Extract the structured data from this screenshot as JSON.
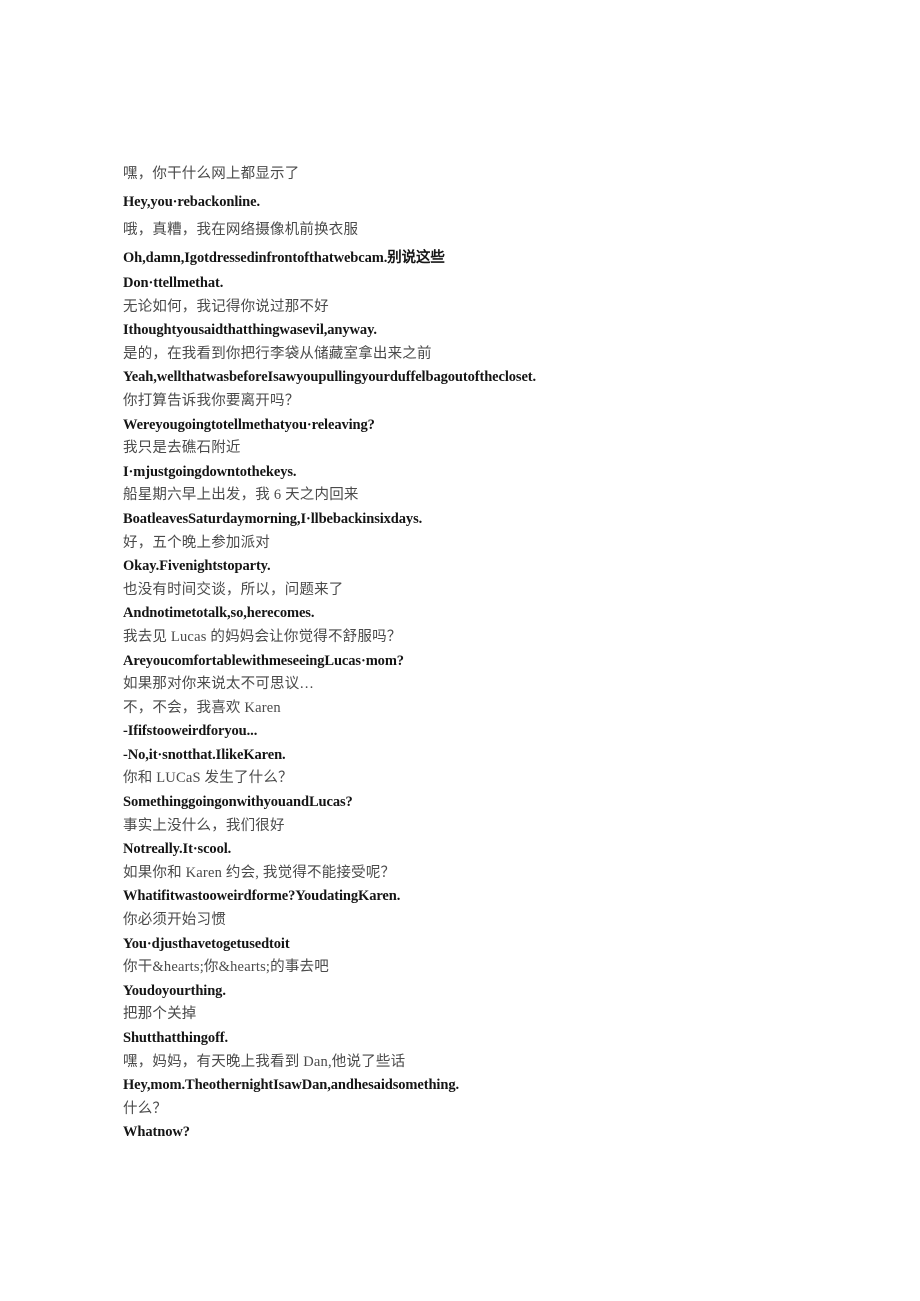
{
  "document": {
    "page_background": "#ffffff",
    "text_color_chinese": "#4a4a4a",
    "text_color_english": "#151515",
    "lines": [
      {
        "id": "l01",
        "lang": "zh",
        "spacing": "loose",
        "text": "嘿，你干什么网上都显示了"
      },
      {
        "id": "l02",
        "lang": "en",
        "spacing": "loose",
        "text": "Hey,you·rebackonline."
      },
      {
        "id": "l03",
        "lang": "zh",
        "spacing": "loose",
        "text": "哦，真糟，我在网络摄像机前换衣服"
      },
      {
        "id": "l04",
        "lang": "mixed",
        "spacing": "loose",
        "text": "Oh,damn,Igotdressedinfrontofthatwebcam.别说这些"
      },
      {
        "id": "l05",
        "lang": "en",
        "spacing": "normal",
        "text": "Don·ttellmethat."
      },
      {
        "id": "l06",
        "lang": "zh",
        "spacing": "normal",
        "text": "无论如何，我记得你说过那不好"
      },
      {
        "id": "l07",
        "lang": "en",
        "spacing": "normal",
        "text": "Ithoughtyousaidthatthingwasevil,anyway."
      },
      {
        "id": "l08",
        "lang": "zh",
        "spacing": "normal",
        "text": "是的，在我看到你把行李袋从储藏室拿出来之前"
      },
      {
        "id": "l09",
        "lang": "en",
        "spacing": "normal",
        "text": "Yeah,wellthatwasbeforeIsawyoupullingyourduffelbagoutofthecloset."
      },
      {
        "id": "l10",
        "lang": "zh",
        "spacing": "normal",
        "text": "你打算告诉我你要离开吗？"
      },
      {
        "id": "l11",
        "lang": "en",
        "spacing": "normal",
        "text": "Wereyougoingtotellmethatyou·releaving?"
      },
      {
        "id": "l12",
        "lang": "zh",
        "spacing": "normal",
        "text": "我只是去礁石附近"
      },
      {
        "id": "l13",
        "lang": "en",
        "spacing": "normal",
        "text": "I·mjustgoingdowntothekeys."
      },
      {
        "id": "l14",
        "lang": "zh",
        "spacing": "normal",
        "text": "船星期六早上出发，我 6 天之内回来"
      },
      {
        "id": "l15",
        "lang": "en",
        "spacing": "normal",
        "text": "BoatleavesSaturdaymorning,I·llbebackinsixdays."
      },
      {
        "id": "l16",
        "lang": "zh",
        "spacing": "normal",
        "text": "好，五个晚上参加派对"
      },
      {
        "id": "l17",
        "lang": "en",
        "spacing": "normal",
        "text": "Okay.Fivenightstoparty."
      },
      {
        "id": "l18",
        "lang": "zh",
        "spacing": "normal",
        "text": "也没有时间交谈，所以，问题来了"
      },
      {
        "id": "l19",
        "lang": "en",
        "spacing": "normal",
        "text": "Andnotimetotalk,so,herecomes."
      },
      {
        "id": "l20",
        "lang": "zh",
        "spacing": "normal",
        "text": "我去见 Lucas 的妈妈会让你觉得不舒服吗？"
      },
      {
        "id": "l21",
        "lang": "en",
        "spacing": "normal",
        "text": "AreyoucomfortablewithmeseeingLucas·mom?"
      },
      {
        "id": "l22",
        "lang": "zh",
        "spacing": "normal",
        "text": "如果那对你来说太不可思议…"
      },
      {
        "id": "l23",
        "lang": "zh",
        "spacing": "normal",
        "text": "不，不会，我喜欢 Karen"
      },
      {
        "id": "l24",
        "lang": "en",
        "spacing": "normal",
        "text": "-Ififstooweirdforyou..."
      },
      {
        "id": "l25",
        "lang": "en",
        "spacing": "normal",
        "text": "-No,it·snotthat.IlikeKaren."
      },
      {
        "id": "l26",
        "lang": "zh",
        "spacing": "normal",
        "text": "你和 LUCaS 发生了什么？"
      },
      {
        "id": "l27",
        "lang": "en",
        "spacing": "normal",
        "text": "SomethinggoingonwithyouandLucas?"
      },
      {
        "id": "l28",
        "lang": "zh",
        "spacing": "normal",
        "text": "事实上没什么，我们很好"
      },
      {
        "id": "l29",
        "lang": "en",
        "spacing": "normal",
        "text": "Notreally.It·scool."
      },
      {
        "id": "l30",
        "lang": "zh",
        "spacing": "normal",
        "text": "如果你和 Karen 约会, 我觉得不能接受呢？"
      },
      {
        "id": "l31",
        "lang": "en",
        "spacing": "normal",
        "text": "Whatifitwastooweirdforme?YoudatingKaren."
      },
      {
        "id": "l32",
        "lang": "zh",
        "spacing": "normal",
        "text": "你必须开始习惯"
      },
      {
        "id": "l33",
        "lang": "en",
        "spacing": "normal",
        "text": "You·djusthavetogetusedtoit"
      },
      {
        "id": "l34",
        "lang": "zh",
        "spacing": "normal",
        "text": "你干&hearts;你&hearts;的事去吧"
      },
      {
        "id": "l35",
        "lang": "en",
        "spacing": "normal",
        "text": "Youdoyourthing."
      },
      {
        "id": "l36",
        "lang": "zh",
        "spacing": "normal",
        "text": "把那个关掉"
      },
      {
        "id": "l37",
        "lang": "en",
        "spacing": "normal",
        "text": "Shutthatthingoff."
      },
      {
        "id": "l38",
        "lang": "zh",
        "spacing": "normal",
        "text": "嘿，妈妈，有天晚上我看到 Dan,他说了些话"
      },
      {
        "id": "l39",
        "lang": "en",
        "spacing": "normal",
        "text": "Hey,mom.TheothernightIsawDan,andhesaidsomething."
      },
      {
        "id": "l40",
        "lang": "zh",
        "spacing": "normal",
        "text": "什么？"
      },
      {
        "id": "l41",
        "lang": "en",
        "spacing": "normal",
        "text": "Whatnow?"
      }
    ]
  }
}
